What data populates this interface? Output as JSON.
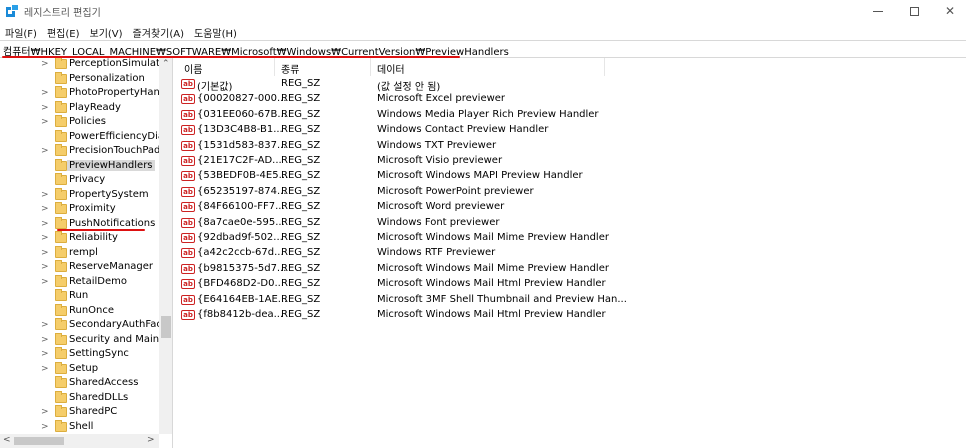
{
  "window": {
    "title": "레지스트리 편집기"
  },
  "menu": [
    "파일(F)",
    "편집(E)",
    "보기(V)",
    "즐겨찾기(A)",
    "도움말(H)"
  ],
  "address": "컴퓨터₩HKEY_LOCAL_MACHINE₩SOFTWARE₩Microsoft₩Windows₩CurrentVersion₩PreviewHandlers",
  "tree": [
    {
      "label": "PerceptionSimulation",
      "expandable": true
    },
    {
      "label": "Personalization",
      "expandable": false
    },
    {
      "label": "PhotoPropertyHandler",
      "expandable": true
    },
    {
      "label": "PlayReady",
      "expandable": true
    },
    {
      "label": "Policies",
      "expandable": true
    },
    {
      "label": "PowerEfficiencyDiagnostics",
      "expandable": false
    },
    {
      "label": "PrecisionTouchPad",
      "expandable": true
    },
    {
      "label": "PreviewHandlers",
      "expandable": false,
      "selected": true
    },
    {
      "label": "Privacy",
      "expandable": false
    },
    {
      "label": "PropertySystem",
      "expandable": true
    },
    {
      "label": "Proximity",
      "expandable": true
    },
    {
      "label": "PushNotifications",
      "expandable": true
    },
    {
      "label": "Reliability",
      "expandable": true
    },
    {
      "label": "rempl",
      "expandable": true
    },
    {
      "label": "ReserveManager",
      "expandable": true
    },
    {
      "label": "RetailDemo",
      "expandable": true
    },
    {
      "label": "Run",
      "expandable": false
    },
    {
      "label": "RunOnce",
      "expandable": false
    },
    {
      "label": "SecondaryAuthFactor",
      "expandable": true
    },
    {
      "label": "Security and Maintenance",
      "expandable": true
    },
    {
      "label": "SettingSync",
      "expandable": true
    },
    {
      "label": "Setup",
      "expandable": true
    },
    {
      "label": "SharedAccess",
      "expandable": false
    },
    {
      "label": "SharedDLLs",
      "expandable": false
    },
    {
      "label": "SharedPC",
      "expandable": true
    },
    {
      "label": "Shell",
      "expandable": true
    }
  ],
  "columns": {
    "name": "이름",
    "type": "종류",
    "data": "데이터"
  },
  "values": [
    {
      "name": "(기본값)",
      "type": "REG_SZ",
      "data": "(값 설정 안 됨)"
    },
    {
      "name": "{00020827-000...",
      "type": "REG_SZ",
      "data": "Microsoft Excel previewer"
    },
    {
      "name": "{031EE060-67B...",
      "type": "REG_SZ",
      "data": "Windows Media Player Rich Preview Handler"
    },
    {
      "name": "{13D3C4B8-B1...",
      "type": "REG_SZ",
      "data": "Windows Contact Preview Handler"
    },
    {
      "name": "{1531d583-837...",
      "type": "REG_SZ",
      "data": "Windows TXT Previewer"
    },
    {
      "name": "{21E17C2F-AD...",
      "type": "REG_SZ",
      "data": "Microsoft Visio previewer"
    },
    {
      "name": "{53BEDF0B-4E5...",
      "type": "REG_SZ",
      "data": "Microsoft Windows MAPI Preview Handler"
    },
    {
      "name": "{65235197-874...",
      "type": "REG_SZ",
      "data": "Microsoft PowerPoint previewer"
    },
    {
      "name": "{84F66100-FF7...",
      "type": "REG_SZ",
      "data": "Microsoft Word previewer"
    },
    {
      "name": "{8a7cae0e-595...",
      "type": "REG_SZ",
      "data": "Windows Font previewer"
    },
    {
      "name": "{92dbad9f-502...",
      "type": "REG_SZ",
      "data": "Microsoft Windows Mail Mime Preview Handler"
    },
    {
      "name": "{a42c2ccb-67d...",
      "type": "REG_SZ",
      "data": "Windows RTF Previewer"
    },
    {
      "name": "{b9815375-5d7...",
      "type": "REG_SZ",
      "data": "Microsoft Windows Mail Mime Preview Handler"
    },
    {
      "name": "{BFD468D2-D0...",
      "type": "REG_SZ",
      "data": "Microsoft Windows Mail Html Preview Handler"
    },
    {
      "name": "{E64164EB-1AE...",
      "type": "REG_SZ",
      "data": "Microsoft 3MF Shell Thumbnail and Preview Han..."
    },
    {
      "name": "{f8b8412b-dea...",
      "type": "REG_SZ",
      "data": "Microsoft Windows Mail Html Preview Handler"
    }
  ],
  "colors": {
    "annotation": "#dd1111",
    "folder": "#f5cd6a",
    "selection": "#d9d9d9"
  },
  "icons": {
    "app": "registry-editor-icon",
    "value": "string-value-icon",
    "folder": "folder-icon"
  }
}
